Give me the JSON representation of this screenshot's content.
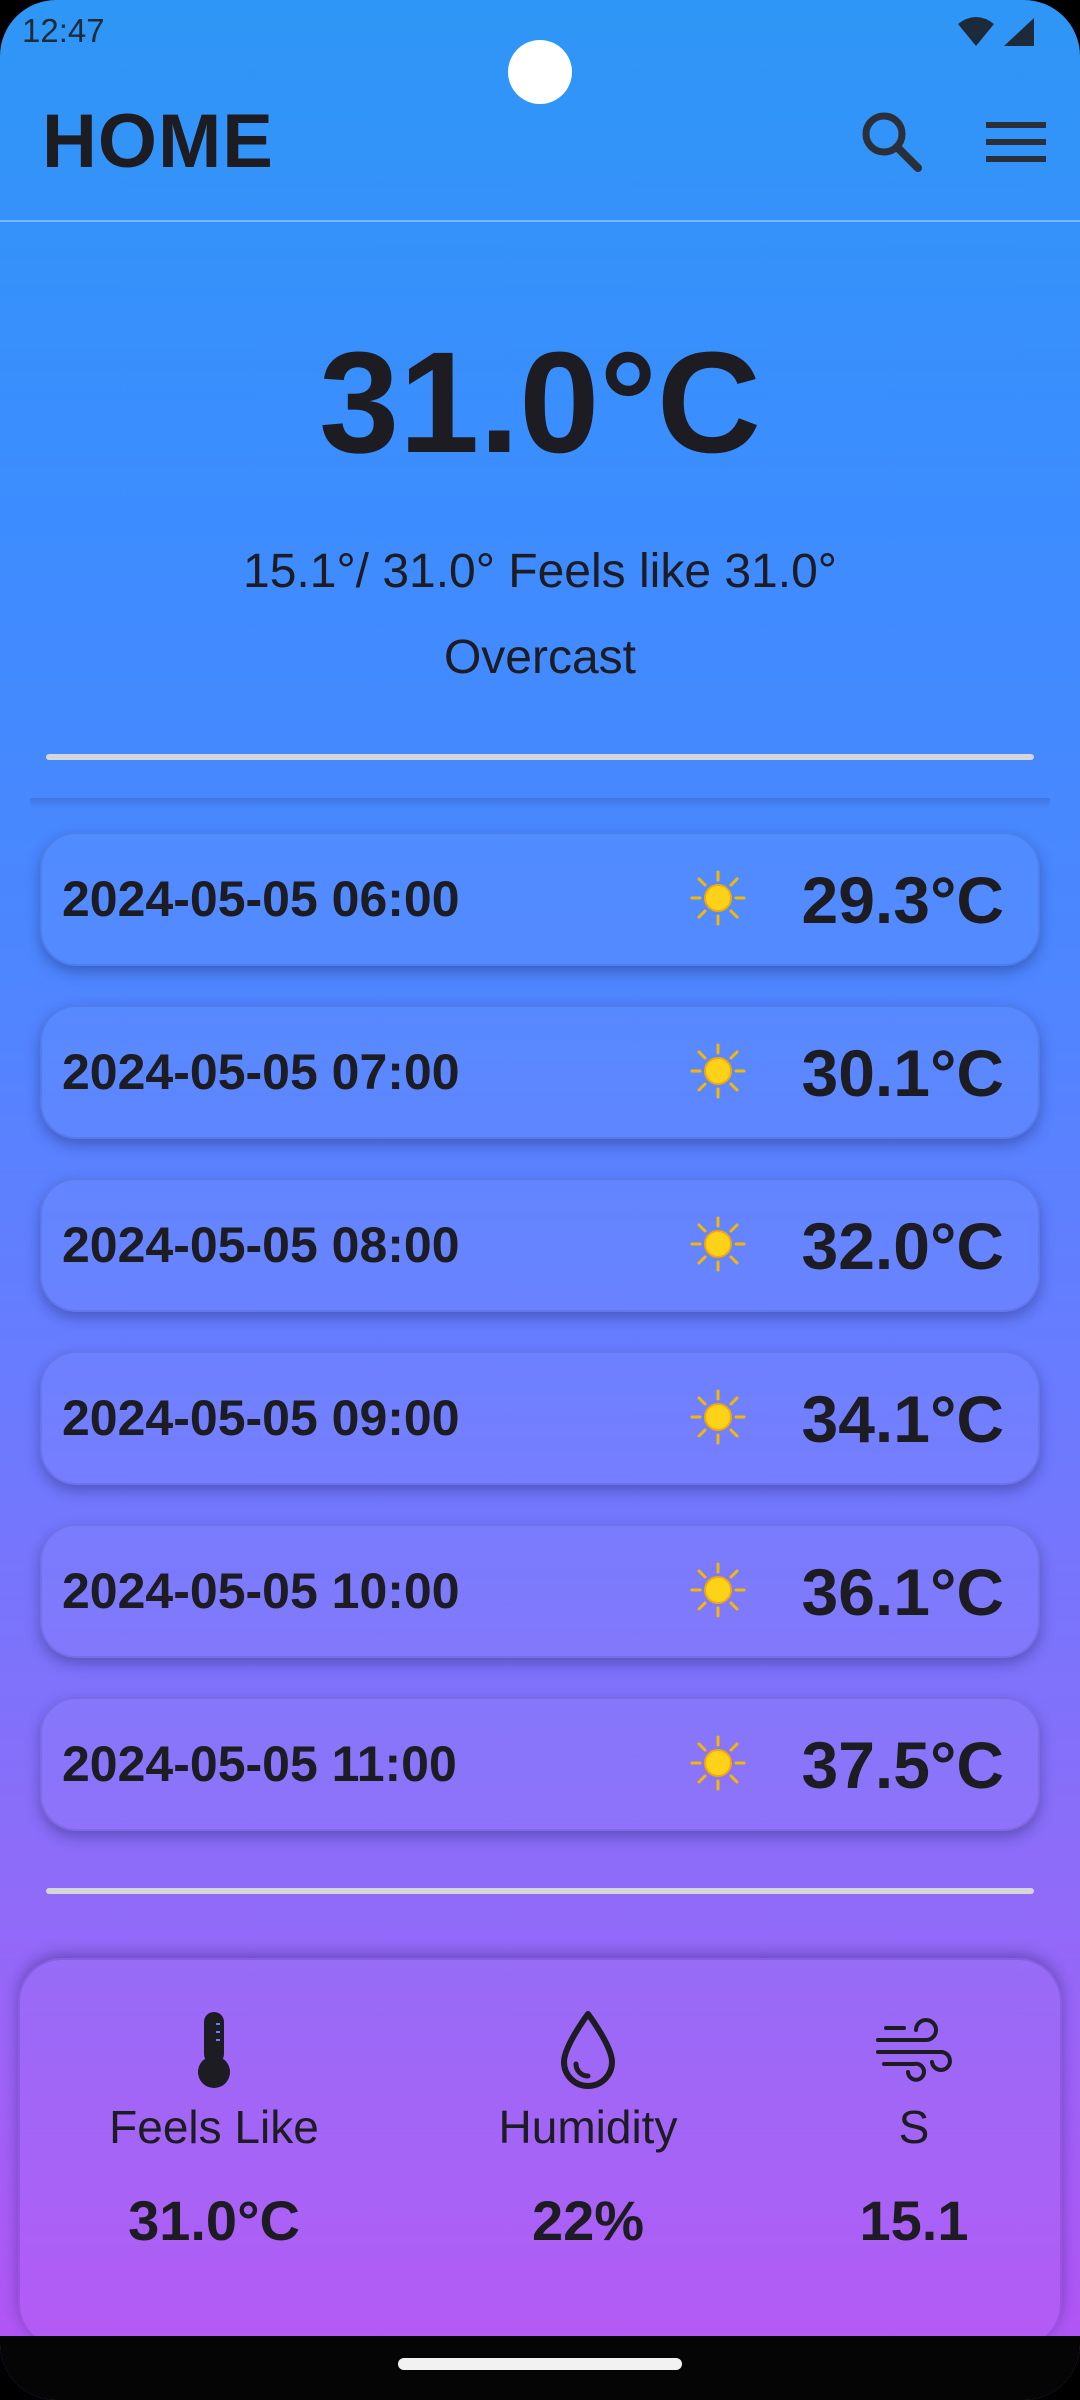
{
  "status_bar": {
    "time": "12:47"
  },
  "app_bar": {
    "title": "HOME",
    "search_icon": "search-icon",
    "menu_icon": "hamburger-menu-icon"
  },
  "current": {
    "temperature": "31.0°C",
    "range_feels": "15.1°/ 31.0° Feels like 31.0°",
    "condition": "Overcast"
  },
  "hourly": [
    {
      "time": "2024-05-05 06:00",
      "icon": "sun-icon",
      "temp": "29.3°C"
    },
    {
      "time": "2024-05-05 07:00",
      "icon": "sun-icon",
      "temp": "30.1°C"
    },
    {
      "time": "2024-05-05 08:00",
      "icon": "sun-icon",
      "temp": "32.0°C"
    },
    {
      "time": "2024-05-05 09:00",
      "icon": "sun-icon",
      "temp": "34.1°C"
    },
    {
      "time": "2024-05-05 10:00",
      "icon": "sun-icon",
      "temp": "36.1°C"
    },
    {
      "time": "2024-05-05 11:00",
      "icon": "sun-icon",
      "temp": "37.5°C"
    }
  ],
  "details": {
    "feels_like": {
      "icon": "thermometer-icon",
      "label": "Feels Like",
      "value": "31.0°C"
    },
    "humidity": {
      "icon": "water-drop-icon",
      "label": "Humidity",
      "value": "22%"
    },
    "wind": {
      "icon": "wind-icon",
      "label": "S",
      "value": "15.1"
    }
  },
  "colors": {
    "gradient_top": "#2e96f6",
    "gradient_bottom": "#b653f4",
    "text": "#1c1c22",
    "sun": "#ffd21a"
  }
}
